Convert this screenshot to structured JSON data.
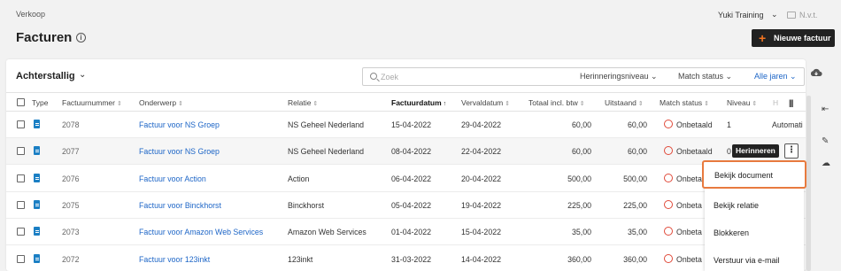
{
  "header": {
    "breadcrumb": "Verkoop",
    "title": "Facturen",
    "company": "Yuki Training",
    "administration": "N.v.t.",
    "new_invoice_button": "Nieuwe factuur"
  },
  "toolbar": {
    "filter": "Achterstallig",
    "search_placeholder": "Zoek",
    "reminder_level": "Herinneringsniveau",
    "match_status": "Match status",
    "years": "Alle jaren"
  },
  "columns": {
    "type": "Type",
    "invoice_number": "Factuurnummer",
    "subject": "Onderwerp",
    "relation": "Relatie",
    "invoice_date": "Factuurdatum",
    "due_date": "Vervaldatum",
    "total": "Totaal incl. btw",
    "outstanding": "Uitstaand",
    "match_status": "Match status",
    "level": "Niveau",
    "h": "H"
  },
  "rows": [
    {
      "number": "2078",
      "subject": "Factuur voor NS Groep",
      "relation": "NS Geheel Nederland",
      "invoice_date": "15-04-2022",
      "due_date": "29-04-2022",
      "total": "60,00",
      "outstanding": "60,00",
      "status": "Onbetaald",
      "level": "1",
      "extra": "Automati"
    },
    {
      "number": "2077",
      "subject": "Factuur voor NS Groep",
      "relation": "NS Geheel Nederland",
      "invoice_date": "08-04-2022",
      "due_date": "22-04-2022",
      "total": "60,00",
      "outstanding": "60,00",
      "status": "Onbetaald",
      "level": "0",
      "extra": ""
    },
    {
      "number": "2076",
      "subject": "Factuur voor Action",
      "relation": "Action",
      "invoice_date": "06-04-2022",
      "due_date": "20-04-2022",
      "total": "500,00",
      "outstanding": "500,00",
      "status": "Onbeta",
      "level": "",
      "extra": ""
    },
    {
      "number": "2075",
      "subject": "Factuur voor Binckhorst",
      "relation": "Binckhorst",
      "invoice_date": "05-04-2022",
      "due_date": "19-04-2022",
      "total": "225,00",
      "outstanding": "225,00",
      "status": "Onbeta",
      "level": "",
      "extra": ""
    },
    {
      "number": "2073",
      "subject": "Factuur voor Amazon Web Services",
      "relation": "Amazon Web Services",
      "invoice_date": "01-04-2022",
      "due_date": "15-04-2022",
      "total": "35,00",
      "outstanding": "35,00",
      "status": "Onbeta",
      "level": "",
      "extra": ""
    },
    {
      "number": "2072",
      "subject": "Factuur voor 123inkt",
      "relation": "123inkt",
      "invoice_date": "31-03-2022",
      "due_date": "14-04-2022",
      "total": "360,00",
      "outstanding": "360,00",
      "status": "Onbeta",
      "level": "",
      "extra": ""
    }
  ],
  "tooltip": "Herinneren",
  "context_menu": [
    "Bekijk document",
    "Bekijk relatie",
    "Blokkeren",
    "Verstuur via e-mail"
  ],
  "colors": {
    "accent": "#f47521",
    "link": "#1e66c7",
    "status_unpaid": "#e04a3a",
    "focus_outline": "#e87a3e"
  }
}
